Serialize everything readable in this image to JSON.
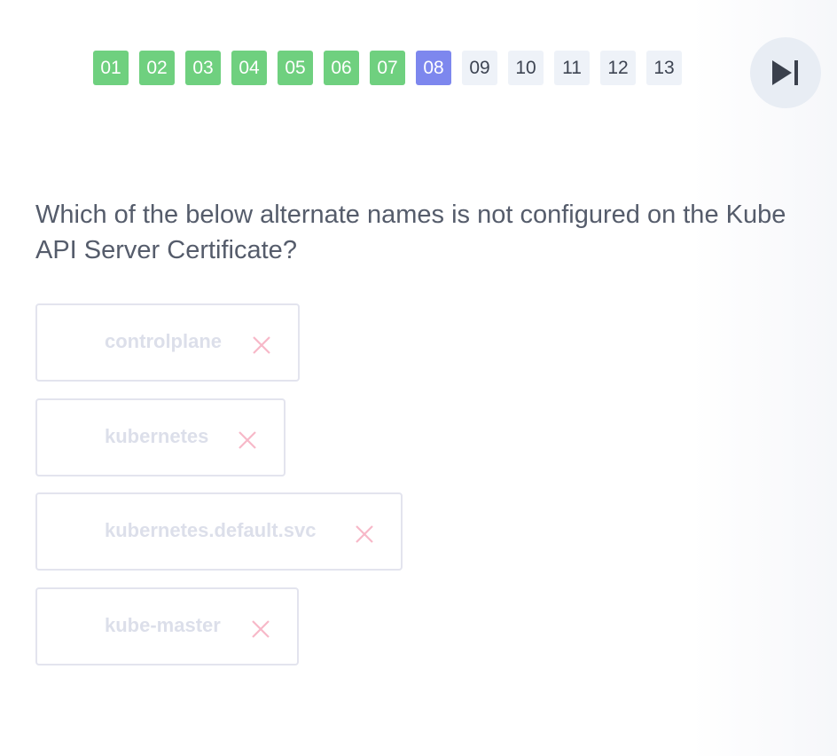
{
  "quiz_nav": {
    "questions": [
      {
        "label": "01",
        "status": "done"
      },
      {
        "label": "02",
        "status": "done"
      },
      {
        "label": "03",
        "status": "done"
      },
      {
        "label": "04",
        "status": "done"
      },
      {
        "label": "05",
        "status": "done"
      },
      {
        "label": "06",
        "status": "done"
      },
      {
        "label": "07",
        "status": "done"
      },
      {
        "label": "08",
        "status": "current"
      },
      {
        "label": "09",
        "status": "todo"
      },
      {
        "label": "10",
        "status": "todo"
      },
      {
        "label": "11",
        "status": "todo"
      },
      {
        "label": "12",
        "status": "todo"
      },
      {
        "label": "13",
        "status": "todo"
      }
    ],
    "skip_icon": "skip-next-icon"
  },
  "question": {
    "text": "Which of the below alternate names is not configured on the Kube API Server Certificate?"
  },
  "options": [
    {
      "label": "controlplane",
      "state": "incorrect",
      "icon": "close-icon"
    },
    {
      "label": "kubernetes",
      "state": "incorrect",
      "icon": "close-icon"
    },
    {
      "label": "kubernetes.default.svc",
      "state": "incorrect",
      "icon": "close-icon"
    },
    {
      "label": "kube-master",
      "state": "incorrect",
      "icon": "close-icon"
    }
  ],
  "colors": {
    "done": "#6fd07f",
    "current": "#7d87ee",
    "todo": "#eef2f8",
    "incorrect_icon": "#f7b8c8",
    "option_text": "#dcdfea",
    "question_text": "#555c6b"
  }
}
